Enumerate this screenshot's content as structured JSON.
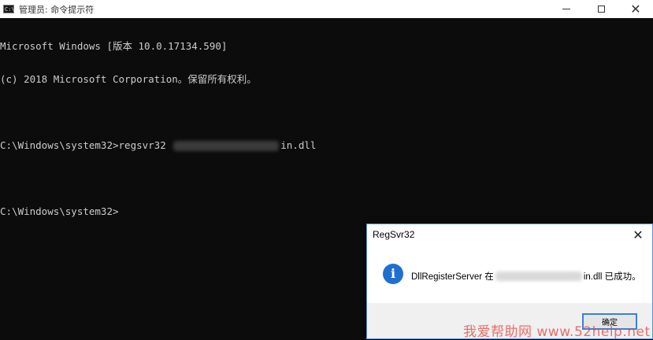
{
  "window": {
    "title": "管理员: 命令提示符",
    "icon": "cmd-icon",
    "controls": {
      "minimize": "minimize-icon",
      "maximize": "maximize-icon",
      "close": "✕"
    }
  },
  "console": {
    "lines": [
      "Microsoft Windows [版本 10.0.17134.590]",
      "(c) 2018 Microsoft Corporation。保留所有权利。",
      "",
      {
        "prefix": "C:\\Windows\\system32>regsvr32 ",
        "suffix": "in.dll"
      },
      "",
      "C:\\Windows\\system32>"
    ]
  },
  "dialog": {
    "title": "RegSvr32",
    "close": "✕",
    "icon": "info-icon",
    "icon_glyph": "i",
    "message_prefix": "DllRegisterServer 在 ",
    "message_suffix": "in.dll 已成功。",
    "ok_label": "确定",
    "accent": "#1f6fd0"
  },
  "watermark": "我爱帮助网 www.52help.net"
}
